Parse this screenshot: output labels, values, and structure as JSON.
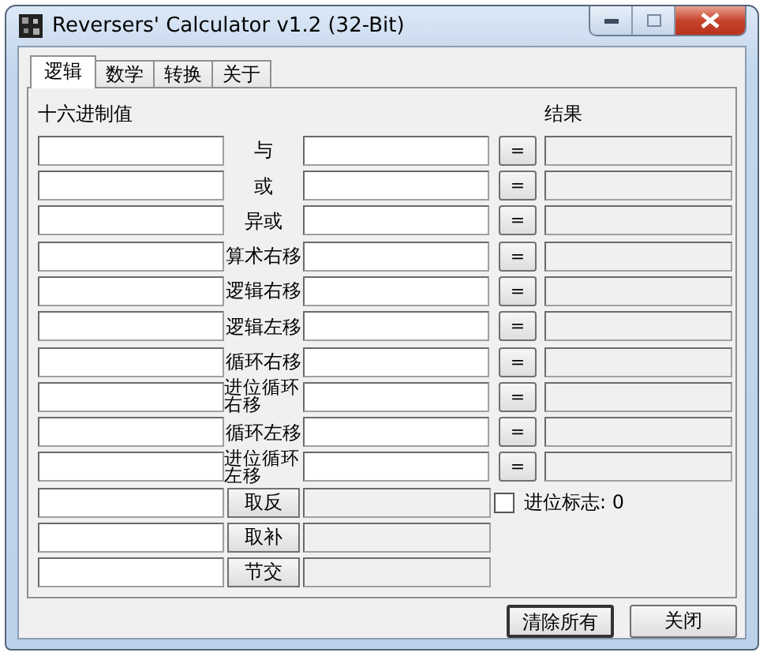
{
  "window": {
    "title": "Reversers' Calculator v1.2 (32-Bit)"
  },
  "tabs": [
    {
      "label": "逻辑",
      "selected": true
    },
    {
      "label": "数学",
      "selected": false
    },
    {
      "label": "转换",
      "selected": false
    },
    {
      "label": "关于",
      "selected": false
    }
  ],
  "headers": {
    "input": "十六进制值",
    "result": "结果"
  },
  "rows": [
    {
      "kind": "binary",
      "op": "与",
      "button": "="
    },
    {
      "kind": "binary",
      "op": "或",
      "button": "="
    },
    {
      "kind": "binary",
      "op": "异或",
      "button": "="
    },
    {
      "kind": "binary",
      "op": "算术右移",
      "button": "="
    },
    {
      "kind": "binary",
      "op": "逻辑右移",
      "button": "="
    },
    {
      "kind": "binary",
      "op": "逻辑左移",
      "button": "="
    },
    {
      "kind": "binary",
      "op": "循环右移",
      "button": "="
    },
    {
      "kind": "binary",
      "op": "进位循环右移",
      "button": "="
    },
    {
      "kind": "binary",
      "op": "循环左移",
      "button": "="
    },
    {
      "kind": "binary",
      "op": "进位循环左移",
      "button": "="
    },
    {
      "kind": "unary",
      "op": "取反"
    },
    {
      "kind": "unary",
      "op": "取补"
    },
    {
      "kind": "unary",
      "op": "节交"
    }
  ],
  "carry_flag": {
    "label": "进位标志: 0",
    "checked": false
  },
  "buttons": [
    "清除所有",
    "关闭"
  ]
}
